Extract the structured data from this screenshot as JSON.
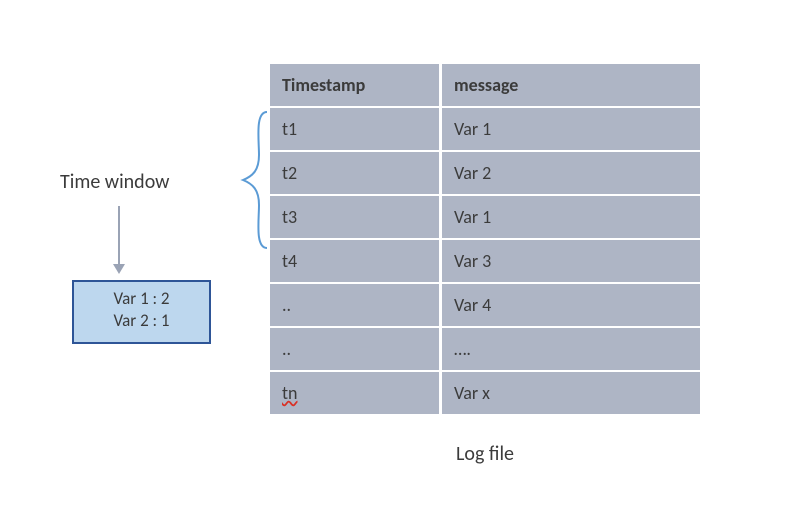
{
  "time_window_label": "Time window",
  "result_box": {
    "line1": "Var 1 : 2",
    "line2": "Var 2 : 1"
  },
  "table": {
    "headers": {
      "timestamp": "Timestamp",
      "message": "message"
    },
    "rows": [
      {
        "timestamp": "t1",
        "message": "Var 1"
      },
      {
        "timestamp": "t2",
        "message": "Var 2"
      },
      {
        "timestamp": "t3",
        "message": "Var 1"
      },
      {
        "timestamp": "t4",
        "message": "Var 3"
      },
      {
        "timestamp": "..",
        "message": "Var 4"
      },
      {
        "timestamp": "..",
        "message": "…."
      },
      {
        "timestamp": "tn",
        "message": "Var x"
      }
    ],
    "wavy_row_index": 6,
    "caption": "Log file"
  },
  "bracket_rows": [
    0,
    1,
    2
  ],
  "colors": {
    "table_cell": "#aeb5c5",
    "box_fill": "#bdd7ee",
    "box_border": "#2e5597",
    "arrow": "#9aa3b5",
    "bracket": "#5b9bd5"
  }
}
